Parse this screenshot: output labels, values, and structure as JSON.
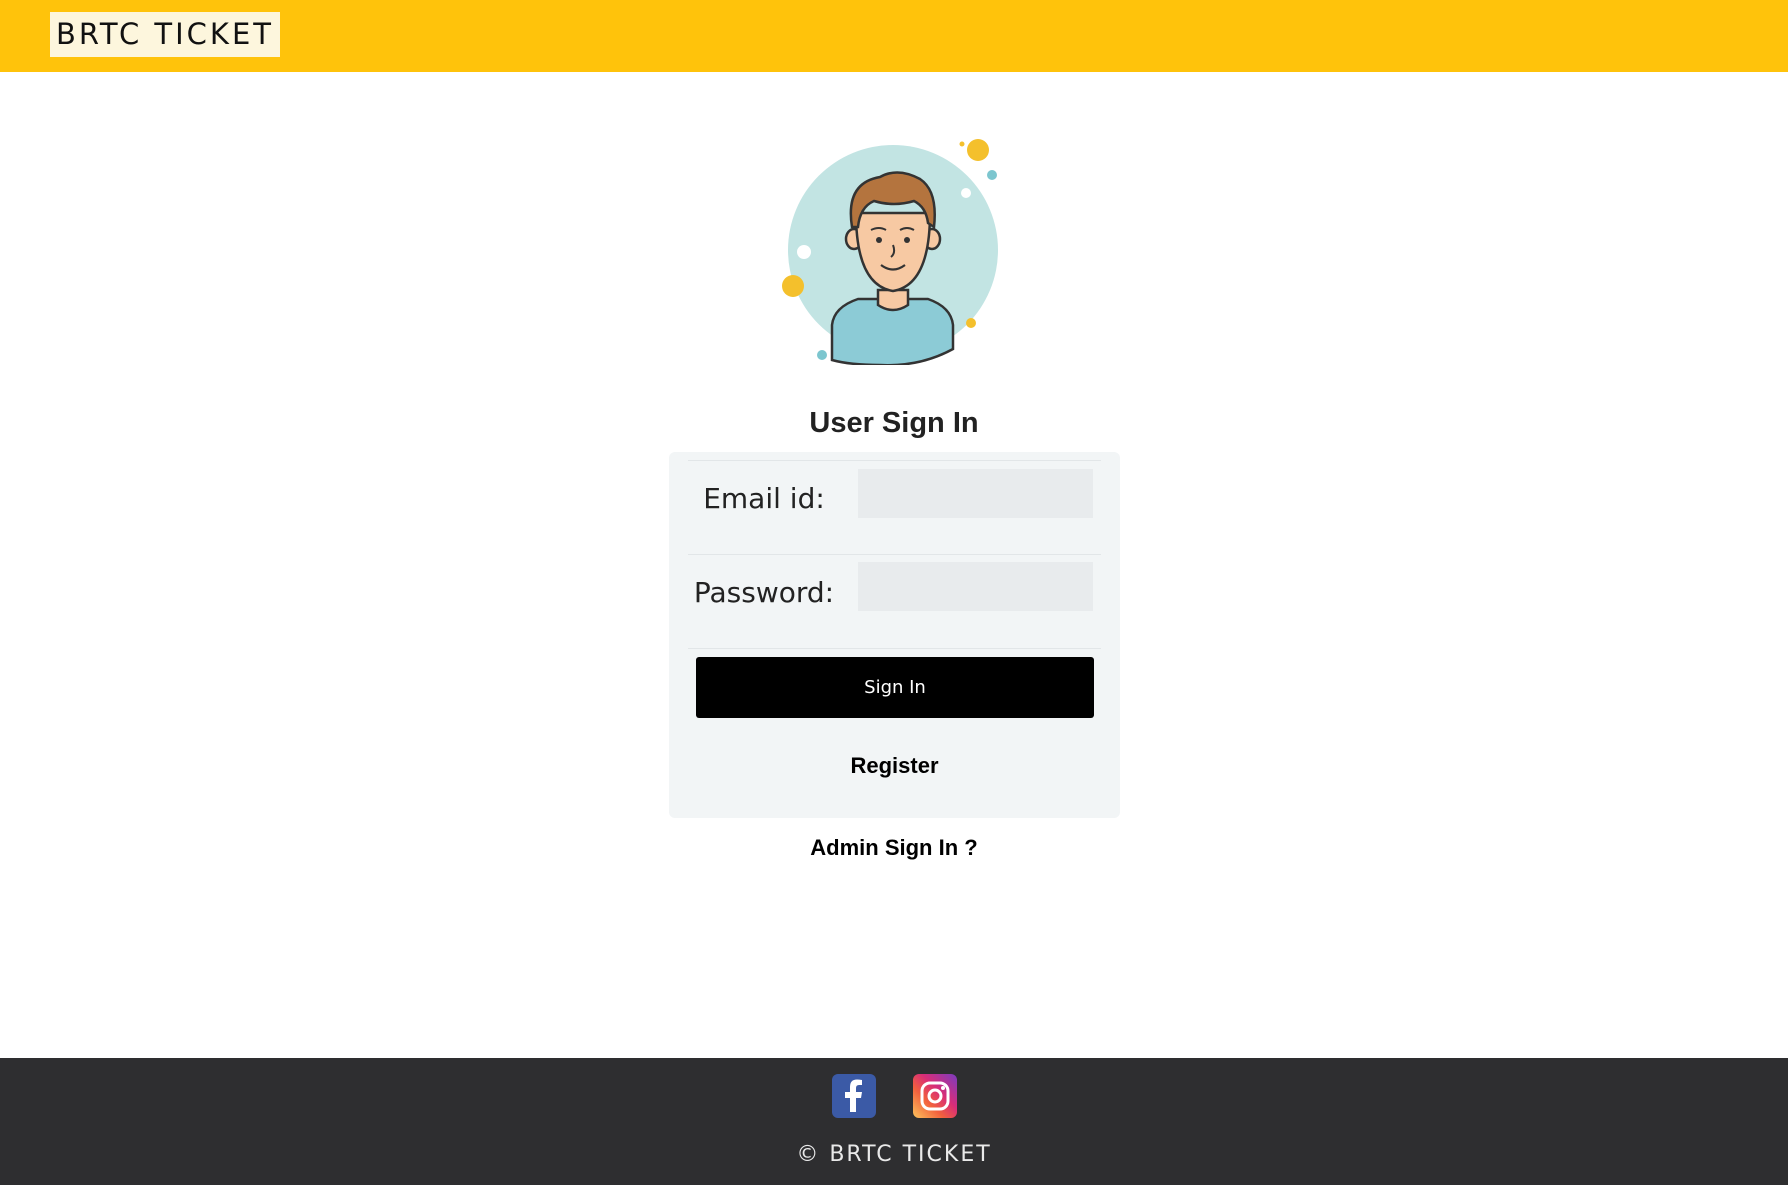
{
  "header": {
    "logo_text": "BRTC TICKET",
    "background_color": "#ffc30b"
  },
  "avatar": {
    "icon": "user-avatar-illustration"
  },
  "form": {
    "title": "User Sign In",
    "email_label": "Email id:",
    "email_value": "",
    "password_label": "Password:",
    "password_value": "",
    "signin_label": "Sign In",
    "register_label": "Register"
  },
  "admin_link": "Admin Sign In ?",
  "footer": {
    "social_icons": [
      "facebook-icon",
      "instagram-icon"
    ],
    "copyright": "© BRTC TICKET",
    "background_color": "#2e2e30"
  }
}
